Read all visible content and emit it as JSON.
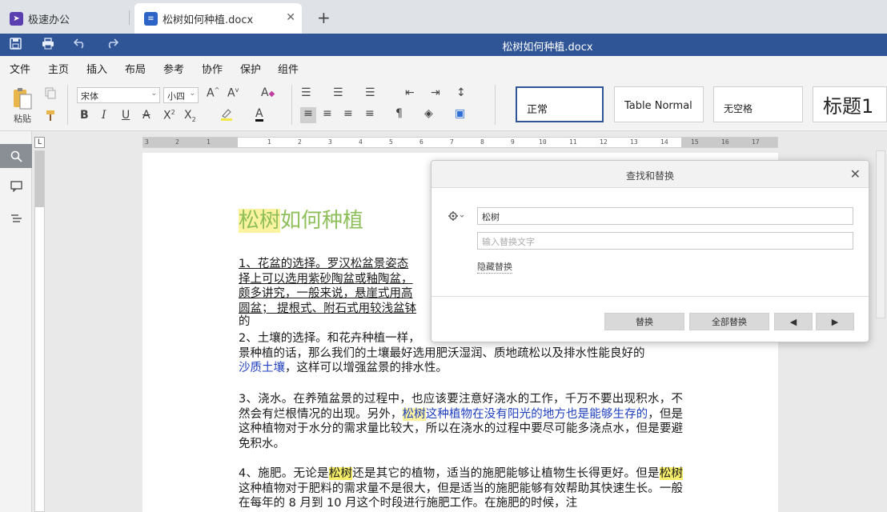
{
  "tabs": {
    "home_label": "极速办公",
    "doc_label": "松树如何种植.docx",
    "close_glyph": "✕",
    "add_glyph": "+"
  },
  "titlebar": {
    "title": "松树如何种植.docx"
  },
  "menu": [
    "文件",
    "主页",
    "插入",
    "布局",
    "参考",
    "协作",
    "保护",
    "组件"
  ],
  "ribbon": {
    "paste_label": "粘贴",
    "font_name": "宋体",
    "font_size": "小四",
    "styles": [
      "正常",
      "Table Normal",
      "无空格",
      "标题1"
    ]
  },
  "ruler": {
    "ticks": [
      "3",
      "2",
      "1",
      "1",
      "2",
      "3",
      "4",
      "5",
      "6",
      "7",
      "8",
      "9",
      "10",
      "11",
      "12",
      "13",
      "14",
      "15",
      "16",
      "17"
    ],
    "corner": "L"
  },
  "document": {
    "title_highlight": "松树",
    "title_rest": "如何种植",
    "p1": "1、花盆的选择。罗汉松盆景姿态",
    "p1_l2": "择上可以选用紫砂陶盆或釉陶盆，",
    "p1_l3": "颇多讲究，一般来说，悬崖式用高",
    "p1_l4": "圆盆；  提根式、附石式用较浅盆钵",
    "p1_l5": "的",
    "p2_a": "2、土壤的选择。和花卉种植一样，",
    "p2_b": "景种植的话，那么我们的土壤最好选用肥沃湿润、质地疏松以及排水性能良好的",
    "p2_c": "沙质土壤",
    "p2_d": "，这样可以增强盆景的排水性。",
    "p3_a": "3、浇水。在养殖盆景的过程中，也应该要注意好浇水的工作，千万不要出现积水，不然会有烂根情况的出现。另外，",
    "p3_hl": "松树",
    "p3_b": "这种植物在没有阳光的地方也是能够生存的",
    "p3_c": "，但是这种植物对于水分的需求量比较大，所以在浇水的过程中要尽可能多浇点水，但是要避免积水。",
    "p4_a": "4、施肥。无论是",
    "p4_hl1": "松树",
    "p4_b": "还是其它的植物，适当的施肥能够让植物生长得更好。但是",
    "p4_hl2": "松树",
    "p4_c": "这种植物对于肥料的需求量不是很大，但是适当的施肥能够有效帮助其快速生长。一般在每年的 8 月到 10 月这个时段进行施肥工作。在施肥的时候，注"
  },
  "dialog": {
    "title": "查找和替换",
    "close_glyph": "✕",
    "search_value": "松树",
    "replace_placeholder": "输入替换文字",
    "hide_replace_label": "隐藏替换",
    "replace_button": "替换",
    "replace_all_button": "全部替换",
    "prev_glyph": "◀",
    "next_glyph": "▶"
  }
}
